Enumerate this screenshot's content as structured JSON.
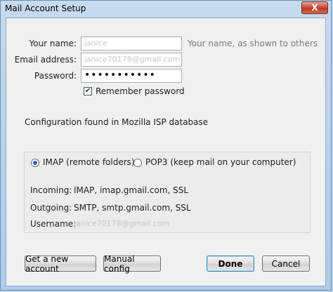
{
  "window": {
    "title": "Mail Account Setup",
    "close_glyph": "X"
  },
  "form": {
    "name_label": "Your name:",
    "name_value": "janice",
    "name_hint": "Your name, as shown to others",
    "email_label": "Email address:",
    "email_value": "janice70178@gmail.com",
    "password_label": "Password:",
    "password_value": "•••••••••••",
    "remember_label": "Remember password",
    "remember_checked": true
  },
  "status": {
    "config_text": "Configuration found in Mozilla ISP database"
  },
  "server": {
    "imap_label": "IMAP (remote folders)",
    "pop3_label": "POP3 (keep mail on your computer)",
    "selected": "IMAP",
    "incoming_label": "Incoming:",
    "incoming_value": "IMAP, imap.gmail.com, SSL",
    "outgoing_label": "Outgoing:",
    "outgoing_value": "SMTP, smtp.gmail.com, SSL",
    "username_label": "Username:",
    "username_value": "janice70178@gmail.com"
  },
  "buttons": {
    "new_account": "Get a new account",
    "manual_config": "Manual config",
    "done": "Done",
    "cancel": "Cancel"
  }
}
